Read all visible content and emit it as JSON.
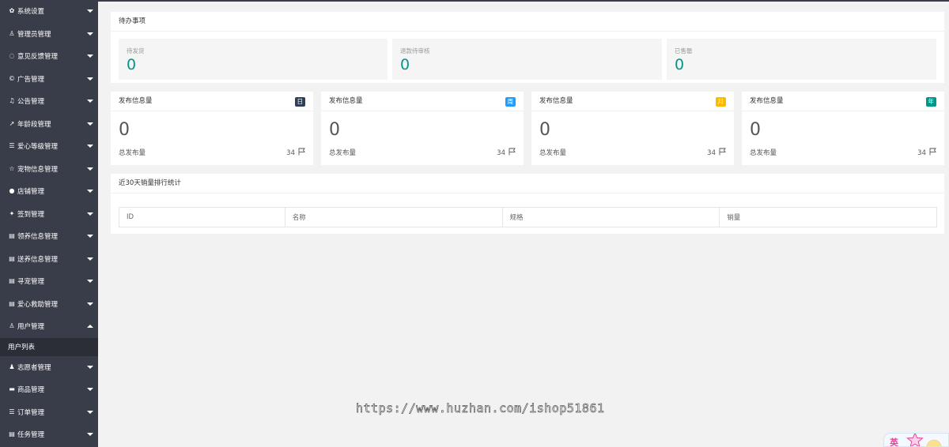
{
  "sidebar": {
    "items": [
      {
        "label": "系统设置",
        "icon": "gear-icon",
        "glyph": "✿"
      },
      {
        "label": "管理员管理",
        "icon": "user-icon",
        "glyph": "♙"
      },
      {
        "label": "意见反馈管理",
        "icon": "chat-icon",
        "glyph": "◌"
      },
      {
        "label": "广告管理",
        "icon": "at-icon",
        "glyph": "©"
      },
      {
        "label": "公告管理",
        "icon": "bell-icon",
        "glyph": "♫"
      },
      {
        "label": "年龄段管理",
        "icon": "chart-line-icon",
        "glyph": "↗"
      },
      {
        "label": "爱心等级管理",
        "icon": "list-icon",
        "glyph": "☰"
      },
      {
        "label": "宠物信息管理",
        "icon": "star-icon",
        "glyph": "☆"
      },
      {
        "label": "店铺管理",
        "icon": "tag-icon",
        "glyph": "●"
      },
      {
        "label": "签到管理",
        "icon": "pin-icon",
        "glyph": "✦"
      },
      {
        "label": "领养信息管理",
        "icon": "list-icon",
        "glyph": "▤"
      },
      {
        "label": "送养信息管理",
        "icon": "list-icon",
        "glyph": "▤"
      },
      {
        "label": "寻宠管理",
        "icon": "list-icon",
        "glyph": "▤"
      },
      {
        "label": "爱心救助管理",
        "icon": "list-icon",
        "glyph": "▤"
      },
      {
        "label": "用户管理",
        "icon": "user-icon",
        "glyph": "♙",
        "open": true,
        "children": [
          "用户列表"
        ]
      },
      {
        "label": "志愿者管理",
        "icon": "users-icon",
        "glyph": "♟"
      },
      {
        "label": "商品管理",
        "icon": "folder-icon",
        "glyph": "▬"
      },
      {
        "label": "订单管理",
        "icon": "list-icon",
        "glyph": "☰"
      },
      {
        "label": "任务管理",
        "icon": "list-icon",
        "glyph": "▤"
      }
    ]
  },
  "todo": {
    "title": "待办事项",
    "boxes": [
      {
        "label": "待发货",
        "value": "0"
      },
      {
        "label": "退款待审核",
        "value": "0"
      },
      {
        "label": "已售罄",
        "value": "0"
      }
    ]
  },
  "stats": [
    {
      "title": "发布信息量",
      "badge": "日",
      "badge_color": "#2f4056",
      "value": "0",
      "footer_label": "总发布量",
      "footer_value": "34"
    },
    {
      "title": "发布信息量",
      "badge": "周",
      "badge_color": "#1e9fff",
      "value": "0",
      "footer_label": "总发布量",
      "footer_value": "34"
    },
    {
      "title": "发布信息量",
      "badge": "月",
      "badge_color": "#ffb800",
      "value": "0",
      "footer_label": "总发布量",
      "footer_value": "34"
    },
    {
      "title": "发布信息量",
      "badge": "年",
      "badge_color": "#009688",
      "value": "0",
      "footer_label": "总发布量",
      "footer_value": "34"
    }
  ],
  "ranking": {
    "title": "近30天销量排行统计",
    "columns": [
      "ID",
      "名称",
      "规格",
      "销量"
    ]
  },
  "watermark": "https://www.huzhan.com/ishop51861",
  "corner_widget": {
    "text": "英"
  },
  "colors": {
    "sidebar_bg": "#393d49",
    "accent": "#009688"
  }
}
